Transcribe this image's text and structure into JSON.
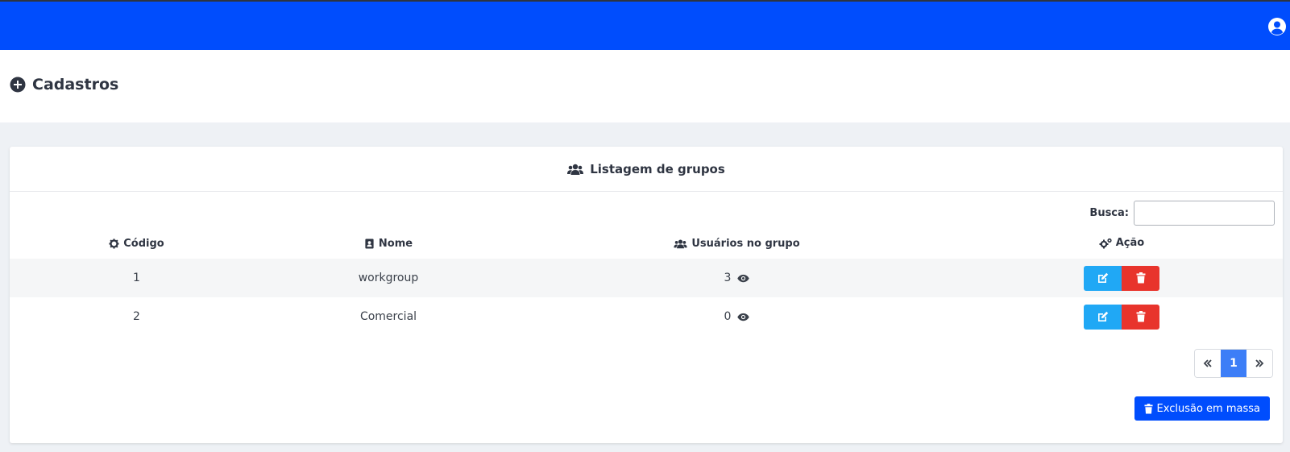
{
  "header": {
    "bg_color": "#004dfd",
    "user_icon": "user-circle-icon"
  },
  "page": {
    "title": "Cadastros",
    "title_icon": "plus-circle-icon"
  },
  "card": {
    "title": "Listagem de grupos",
    "title_icon": "users-icon",
    "search": {
      "label": "Busca:",
      "value": "",
      "placeholder": ""
    },
    "table": {
      "columns": [
        {
          "label": "Código",
          "icon": "cog-icon"
        },
        {
          "label": "Nome",
          "icon": "address-book-icon"
        },
        {
          "label": "Usuários no grupo",
          "icon": "users-icon"
        },
        {
          "label": "Ação",
          "icon": "cogs-icon"
        }
      ],
      "rows": [
        {
          "code": "1",
          "name": "workgroup",
          "users": "3"
        },
        {
          "code": "2",
          "name": "Comercial",
          "users": "0"
        }
      ]
    },
    "pagination": {
      "prev": "«",
      "current": "1",
      "next": "»"
    },
    "mass_delete_label": "Exclusão em massa"
  },
  "colors": {
    "edit": "#20a8f5",
    "delete": "#e8342c",
    "primary": "#004dfd",
    "page_active": "#3d7ef7"
  }
}
